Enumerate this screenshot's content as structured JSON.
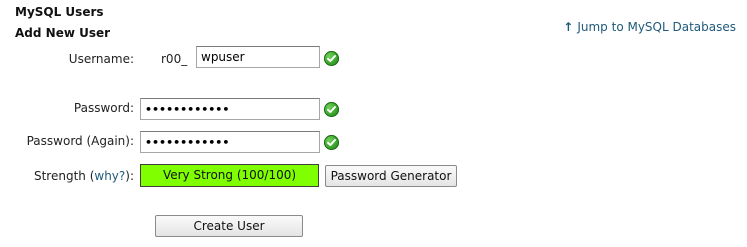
{
  "section": {
    "title": "MySQL Users",
    "subtitle": "Add New User"
  },
  "jump_link": {
    "arrow": "↑",
    "label": "Jump to MySQL Databases"
  },
  "form": {
    "username": {
      "label": "Username:",
      "prefix": "r00_",
      "value": "wpuser"
    },
    "password": {
      "label": "Password:",
      "value": "••••••••••••"
    },
    "password_again": {
      "label": "Password (Again):",
      "value": "••••••••••••"
    },
    "strength": {
      "label_prefix": "Strength (",
      "why_link": "why?",
      "label_suffix": "):",
      "meter_text": "Very Strong (100/100)",
      "score": 100,
      "max": 100,
      "color": "#7fff00"
    },
    "generator_button": "Password Generator",
    "submit_button": "Create User"
  },
  "icons": {
    "valid": "check-circle-icon",
    "jump": "arrow-up-icon"
  }
}
